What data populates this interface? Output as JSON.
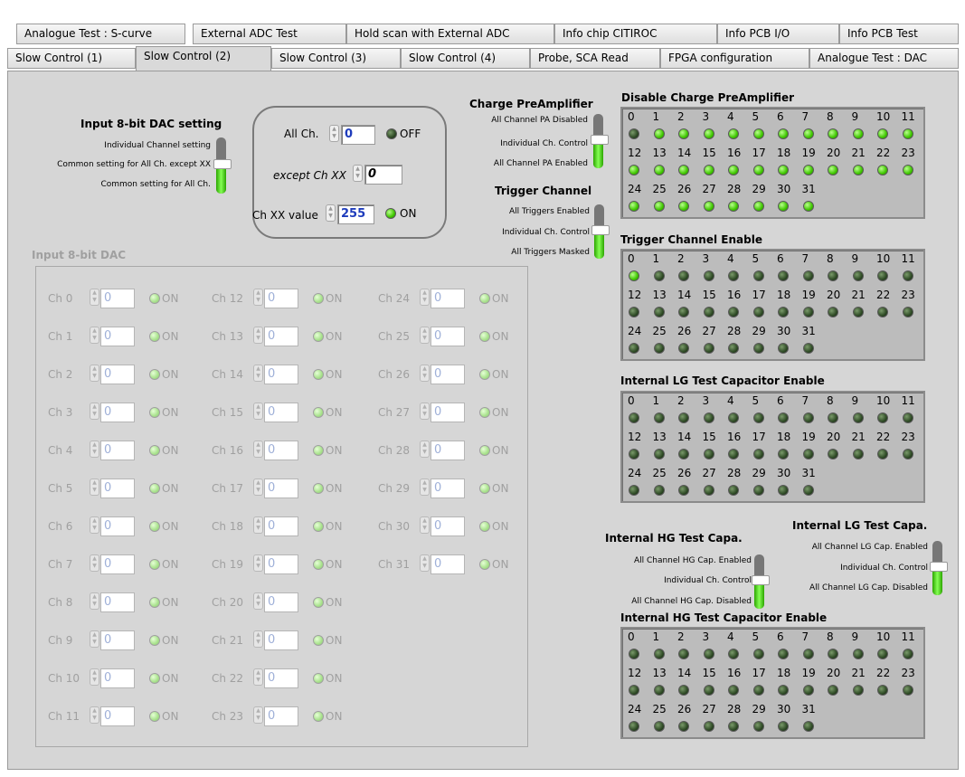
{
  "tabs": {
    "row1": [
      "Analogue Test : S-curve",
      "External ADC Test",
      "Hold scan with External ADC",
      "Info chip CITIROC",
      "Info PCB I/O",
      "Info PCB Test"
    ],
    "row2": [
      "Slow Control (1)",
      "Slow Control (2)",
      "Slow Control (3)",
      "Slow Control (4)",
      "Probe, SCA Read",
      "FPGA configuration",
      "Analogue Test : DAC"
    ],
    "active": "Slow Control (2)"
  },
  "dac_setting": {
    "title": "Input 8-bit DAC setting",
    "options": [
      "Individual Channel setting",
      "Common setting for All Ch. except XX",
      "Common setting for All Ch."
    ],
    "selected_index": 1
  },
  "common": {
    "all_ch_label": "All Ch.",
    "all_ch_value": "0",
    "all_ch_led": "OFF",
    "except_label": "except Ch XX",
    "except_value": "0",
    "chxx_label": "Ch XX value",
    "chxx_value": "255",
    "chxx_led": "ON"
  },
  "dac": {
    "title": "Input 8-bit DAC",
    "channels": [
      {
        "label": "Ch 0",
        "value": "0",
        "status": "ON"
      },
      {
        "label": "Ch 1",
        "value": "0",
        "status": "ON"
      },
      {
        "label": "Ch 2",
        "value": "0",
        "status": "ON"
      },
      {
        "label": "Ch 3",
        "value": "0",
        "status": "ON"
      },
      {
        "label": "Ch 4",
        "value": "0",
        "status": "ON"
      },
      {
        "label": "Ch 5",
        "value": "0",
        "status": "ON"
      },
      {
        "label": "Ch 6",
        "value": "0",
        "status": "ON"
      },
      {
        "label": "Ch 7",
        "value": "0",
        "status": "ON"
      },
      {
        "label": "Ch 8",
        "value": "0",
        "status": "ON"
      },
      {
        "label": "Ch 9",
        "value": "0",
        "status": "ON"
      },
      {
        "label": "Ch 10",
        "value": "0",
        "status": "ON"
      },
      {
        "label": "Ch 11",
        "value": "0",
        "status": "ON"
      },
      {
        "label": "Ch 12",
        "value": "0",
        "status": "ON"
      },
      {
        "label": "Ch 13",
        "value": "0",
        "status": "ON"
      },
      {
        "label": "Ch 14",
        "value": "0",
        "status": "ON"
      },
      {
        "label": "Ch 15",
        "value": "0",
        "status": "ON"
      },
      {
        "label": "Ch 16",
        "value": "0",
        "status": "ON"
      },
      {
        "label": "Ch 17",
        "value": "0",
        "status": "ON"
      },
      {
        "label": "Ch 18",
        "value": "0",
        "status": "ON"
      },
      {
        "label": "Ch 19",
        "value": "0",
        "status": "ON"
      },
      {
        "label": "Ch 20",
        "value": "0",
        "status": "ON"
      },
      {
        "label": "Ch 21",
        "value": "0",
        "status": "ON"
      },
      {
        "label": "Ch 22",
        "value": "0",
        "status": "ON"
      },
      {
        "label": "Ch 23",
        "value": "0",
        "status": "ON"
      },
      {
        "label": "Ch 24",
        "value": "0",
        "status": "ON"
      },
      {
        "label": "Ch 25",
        "value": "0",
        "status": "ON"
      },
      {
        "label": "Ch 26",
        "value": "0",
        "status": "ON"
      },
      {
        "label": "Ch 27",
        "value": "0",
        "status": "ON"
      },
      {
        "label": "Ch 28",
        "value": "0",
        "status": "ON"
      },
      {
        "label": "Ch 29",
        "value": "0",
        "status": "ON"
      },
      {
        "label": "Ch 30",
        "value": "0",
        "status": "ON"
      },
      {
        "label": "Ch 31",
        "value": "0",
        "status": "ON"
      }
    ]
  },
  "charge_preamp": {
    "title": "Charge PreAmplifier",
    "options": [
      "All Channel PA Disabled",
      "Individual Ch. Control",
      "All Channel PA Enabled"
    ],
    "selected_index": 1
  },
  "trigger_channel": {
    "title": "Trigger Channel",
    "options": [
      "All Triggers Enabled",
      "Individual Ch. Control",
      "All Triggers Masked"
    ],
    "selected_index": 1
  },
  "hg_capa": {
    "title": "Internal HG Test Capa.",
    "options": [
      "All Channel HG Cap. Enabled",
      "Individual Ch. Control",
      "All Channel HG Cap. Disabled"
    ],
    "selected_index": 1
  },
  "lg_capa": {
    "title": "Internal LG Test Capa.",
    "options": [
      "All Channel LG Cap. Enabled",
      "Individual Ch. Control",
      "All Channel LG Cap. Disabled"
    ],
    "selected_index": 1
  },
  "led_grids": [
    {
      "title": "Disable Charge PreAmplifier",
      "on": [
        false,
        true,
        true,
        true,
        true,
        true,
        true,
        true,
        true,
        true,
        true,
        true,
        true,
        true,
        true,
        true,
        true,
        true,
        true,
        true,
        true,
        true,
        true,
        true,
        true,
        true,
        true,
        true,
        true,
        true,
        true,
        true
      ]
    },
    {
      "title": "Trigger Channel Enable",
      "on": [
        true,
        false,
        false,
        false,
        false,
        false,
        false,
        false,
        false,
        false,
        false,
        false,
        false,
        false,
        false,
        false,
        false,
        false,
        false,
        false,
        false,
        false,
        false,
        false,
        false,
        false,
        false,
        false,
        false,
        false,
        false,
        false
      ]
    },
    {
      "title": "Internal LG Test Capacitor Enable",
      "on": [
        false,
        false,
        false,
        false,
        false,
        false,
        false,
        false,
        false,
        false,
        false,
        false,
        false,
        false,
        false,
        false,
        false,
        false,
        false,
        false,
        false,
        false,
        false,
        false,
        false,
        false,
        false,
        false,
        false,
        false,
        false,
        false
      ]
    },
    {
      "title": "Internal HG Test Capacitor Enable",
      "on": [
        false,
        false,
        false,
        false,
        false,
        false,
        false,
        false,
        false,
        false,
        false,
        false,
        false,
        false,
        false,
        false,
        false,
        false,
        false,
        false,
        false,
        false,
        false,
        false,
        false,
        false,
        false,
        false,
        false,
        false,
        false,
        false
      ]
    }
  ],
  "colors": {
    "led_on": "#3fc600",
    "led_off": "#2e4a25",
    "panel": "#d6d6d6",
    "value_text": "#1e3cbc"
  }
}
